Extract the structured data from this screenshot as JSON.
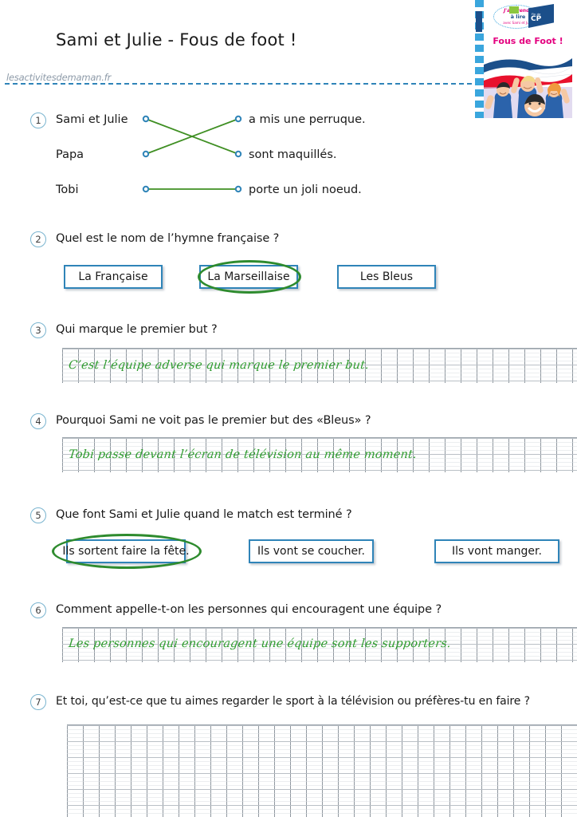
{
  "document": {
    "title": "Sami et Julie - Fous de foot !",
    "watermark": "lesactivitesdemaman.fr"
  },
  "book_cover": {
    "badge_line1": "J'apprends",
    "badge_line2": "à lire",
    "badge_line3": "avec Sami et Julie",
    "level_label": "Fin de",
    "level_value": "CP",
    "title": "Fous de Foot !"
  },
  "questions": [
    {
      "number": "1",
      "type": "matching",
      "left_items": [
        "Sami et Julie",
        "Papa",
        "Tobi"
      ],
      "right_items": [
        "a mis une perruque.",
        "sont maquillés.",
        "porte un joli noeud."
      ],
      "connections": [
        {
          "from": 0,
          "to": 1
        },
        {
          "from": 1,
          "to": 0
        },
        {
          "from": 2,
          "to": 2
        }
      ]
    },
    {
      "number": "2",
      "type": "multiple-choice",
      "prompt": "Quel est le nom de l’hymne française ?",
      "options": [
        "La Française",
        "La Marseillaise",
        "Les Bleus"
      ],
      "selected_index": 1
    },
    {
      "number": "3",
      "type": "written",
      "prompt": "Qui marque le premier but ?",
      "answer": "C’est l’équipe adverse qui marque le premier but."
    },
    {
      "number": "4",
      "type": "written",
      "prompt": "Pourquoi Sami ne voit pas le premier but des «Bleus» ?",
      "answer": "Tobi passe devant l’écran de télévision au même moment."
    },
    {
      "number": "5",
      "type": "multiple-choice",
      "prompt": "Que font Sami et Julie quand le match est terminé ?",
      "options": [
        "Ils sortent faire la fête.",
        "Ils vont se coucher.",
        "Ils vont manger."
      ],
      "selected_index": 0
    },
    {
      "number": "6",
      "type": "written",
      "prompt": "Comment appelle-t-on les personnes qui encouragent une équipe ?",
      "answer": "Les personnes qui encouragent une équipe sont les supporters."
    },
    {
      "number": "7",
      "type": "written-blank",
      "prompt": "Et toi, qu’est-ce que tu aimes regarder le sport à la télévision ou préfères-tu en faire ?",
      "answer": ""
    }
  ],
  "colors": {
    "accent_blue": "#2f84b8",
    "circle_blue": "#79b4cf",
    "green_ink": "#2e9b2e",
    "green_mark": "#2e8b2e",
    "cover_pink": "#e4007f",
    "grid_line": "#9aa3ab"
  }
}
